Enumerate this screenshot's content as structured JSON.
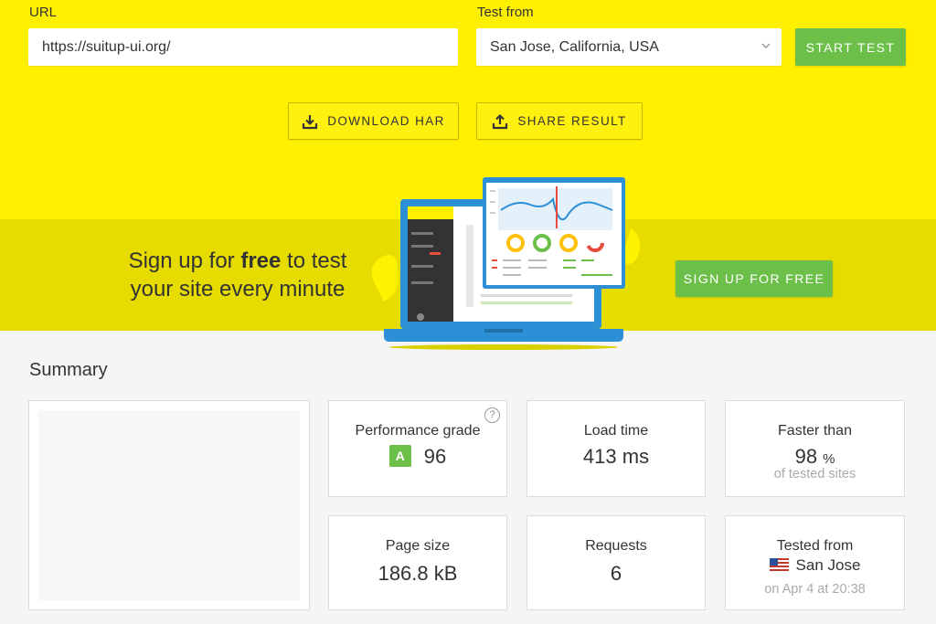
{
  "form": {
    "url_label": "URL",
    "url_value": "https://suitup-ui.org/",
    "location_label": "Test from",
    "location_value": "San Jose, California, USA",
    "start_label": "START TEST"
  },
  "actions": {
    "download_label": "DOWNLOAD HAR",
    "share_label": "SHARE RESULT"
  },
  "promo": {
    "line1_pre": "Sign up for ",
    "line1_bold": "free",
    "line1_post": " to test",
    "line2": "your site every minute",
    "cta_label": "SIGN UP FOR FREE"
  },
  "summary": {
    "heading": "Summary",
    "performance": {
      "title": "Performance grade",
      "grade": "A",
      "score": "96",
      "help": "?"
    },
    "load_time": {
      "title": "Load time",
      "value": "413 ms"
    },
    "faster_than": {
      "title": "Faster than",
      "value": "98",
      "unit": "%",
      "sub": "of tested sites"
    },
    "page_size": {
      "title": "Page size",
      "value": "186.8 kB"
    },
    "requests": {
      "title": "Requests",
      "value": "6"
    },
    "tested_from": {
      "title": "Tested from",
      "value": "San Jose",
      "sub": "on Apr 4 at 20:38"
    }
  },
  "colors": {
    "yellow": "#fff000",
    "promo_yellow": "#e6dc00",
    "green": "#6cc04a",
    "illustration_blue": "#2d8fd5"
  },
  "icons": [
    "download-icon",
    "upload-icon",
    "chevron-down-icon",
    "us-flag-icon",
    "help-icon"
  ]
}
